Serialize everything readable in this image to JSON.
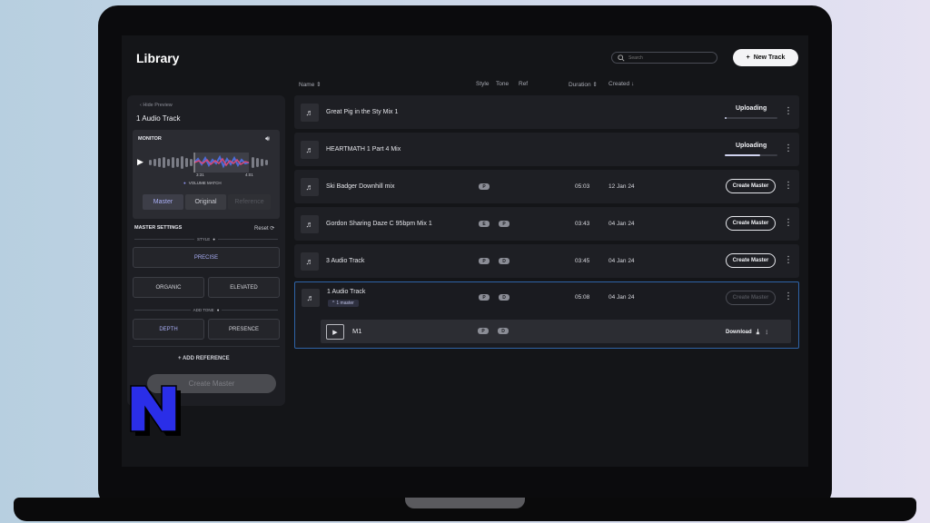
{
  "header": {
    "title": "Library",
    "search_placeholder": "Search",
    "new_track_label": "New Track"
  },
  "columns": {
    "name": "Name",
    "style": "Style",
    "tone": "Tone",
    "ref": "Ref",
    "duration": "Duration",
    "created": "Created"
  },
  "rows": [
    {
      "name": "Great Pig in the Sty Mix 1",
      "status": "Uploading",
      "progress": 0.03
    },
    {
      "name": "HEARTMATH 1 Part 4 Mix",
      "status": "Uploading",
      "progress": 0.68
    },
    {
      "name": "Ski Badger Downhill mix",
      "badges": [
        "P"
      ],
      "duration": "05:03",
      "created": "12 Jan 24",
      "action": "Create Master"
    },
    {
      "name": "Gordon Sharing Daze C 95bpm Mix 1",
      "badges": [
        "E",
        "P"
      ],
      "duration": "03:43",
      "created": "04 Jan 24",
      "action": "Create Master"
    },
    {
      "name": "3 Audio Track",
      "badges": [
        "P",
        "D"
      ],
      "duration": "03:45",
      "created": "04 Jan 24",
      "action": "Create Master"
    },
    {
      "name": "1 Audio Track",
      "sub_tag": "1 master",
      "badges": [
        "P",
        "D"
      ],
      "duration": "05:08",
      "created": "04 Jan 24",
      "action": "Create Master",
      "master": {
        "name": "M1",
        "badges": [
          "P",
          "D"
        ],
        "download_label": "Download"
      }
    }
  ],
  "panel": {
    "hide_preview": "Hide Preview",
    "title": "1 Audio Track",
    "monitor_label": "MONITOR",
    "time_start": "3:31",
    "time_end": "4:01",
    "volume_match": "VOLUME MATCH",
    "segments": [
      "Master",
      "Original",
      "Reference"
    ],
    "master_settings": "MASTER SETTINGS",
    "reset": "Reset",
    "style_label": "STYLE",
    "style_options": [
      "PRECISE",
      "ORGANIC",
      "ELEVATED"
    ],
    "tone_label": "ADD TONE",
    "tone_options": [
      "DEPTH",
      "PRESENCE"
    ],
    "add_reference": "ADD REFERENCE",
    "create_master": "Create Master"
  },
  "colors": {
    "accent": "#a9aef5",
    "selected_border": "#2f64a8",
    "logo": "#2a2ee8"
  }
}
